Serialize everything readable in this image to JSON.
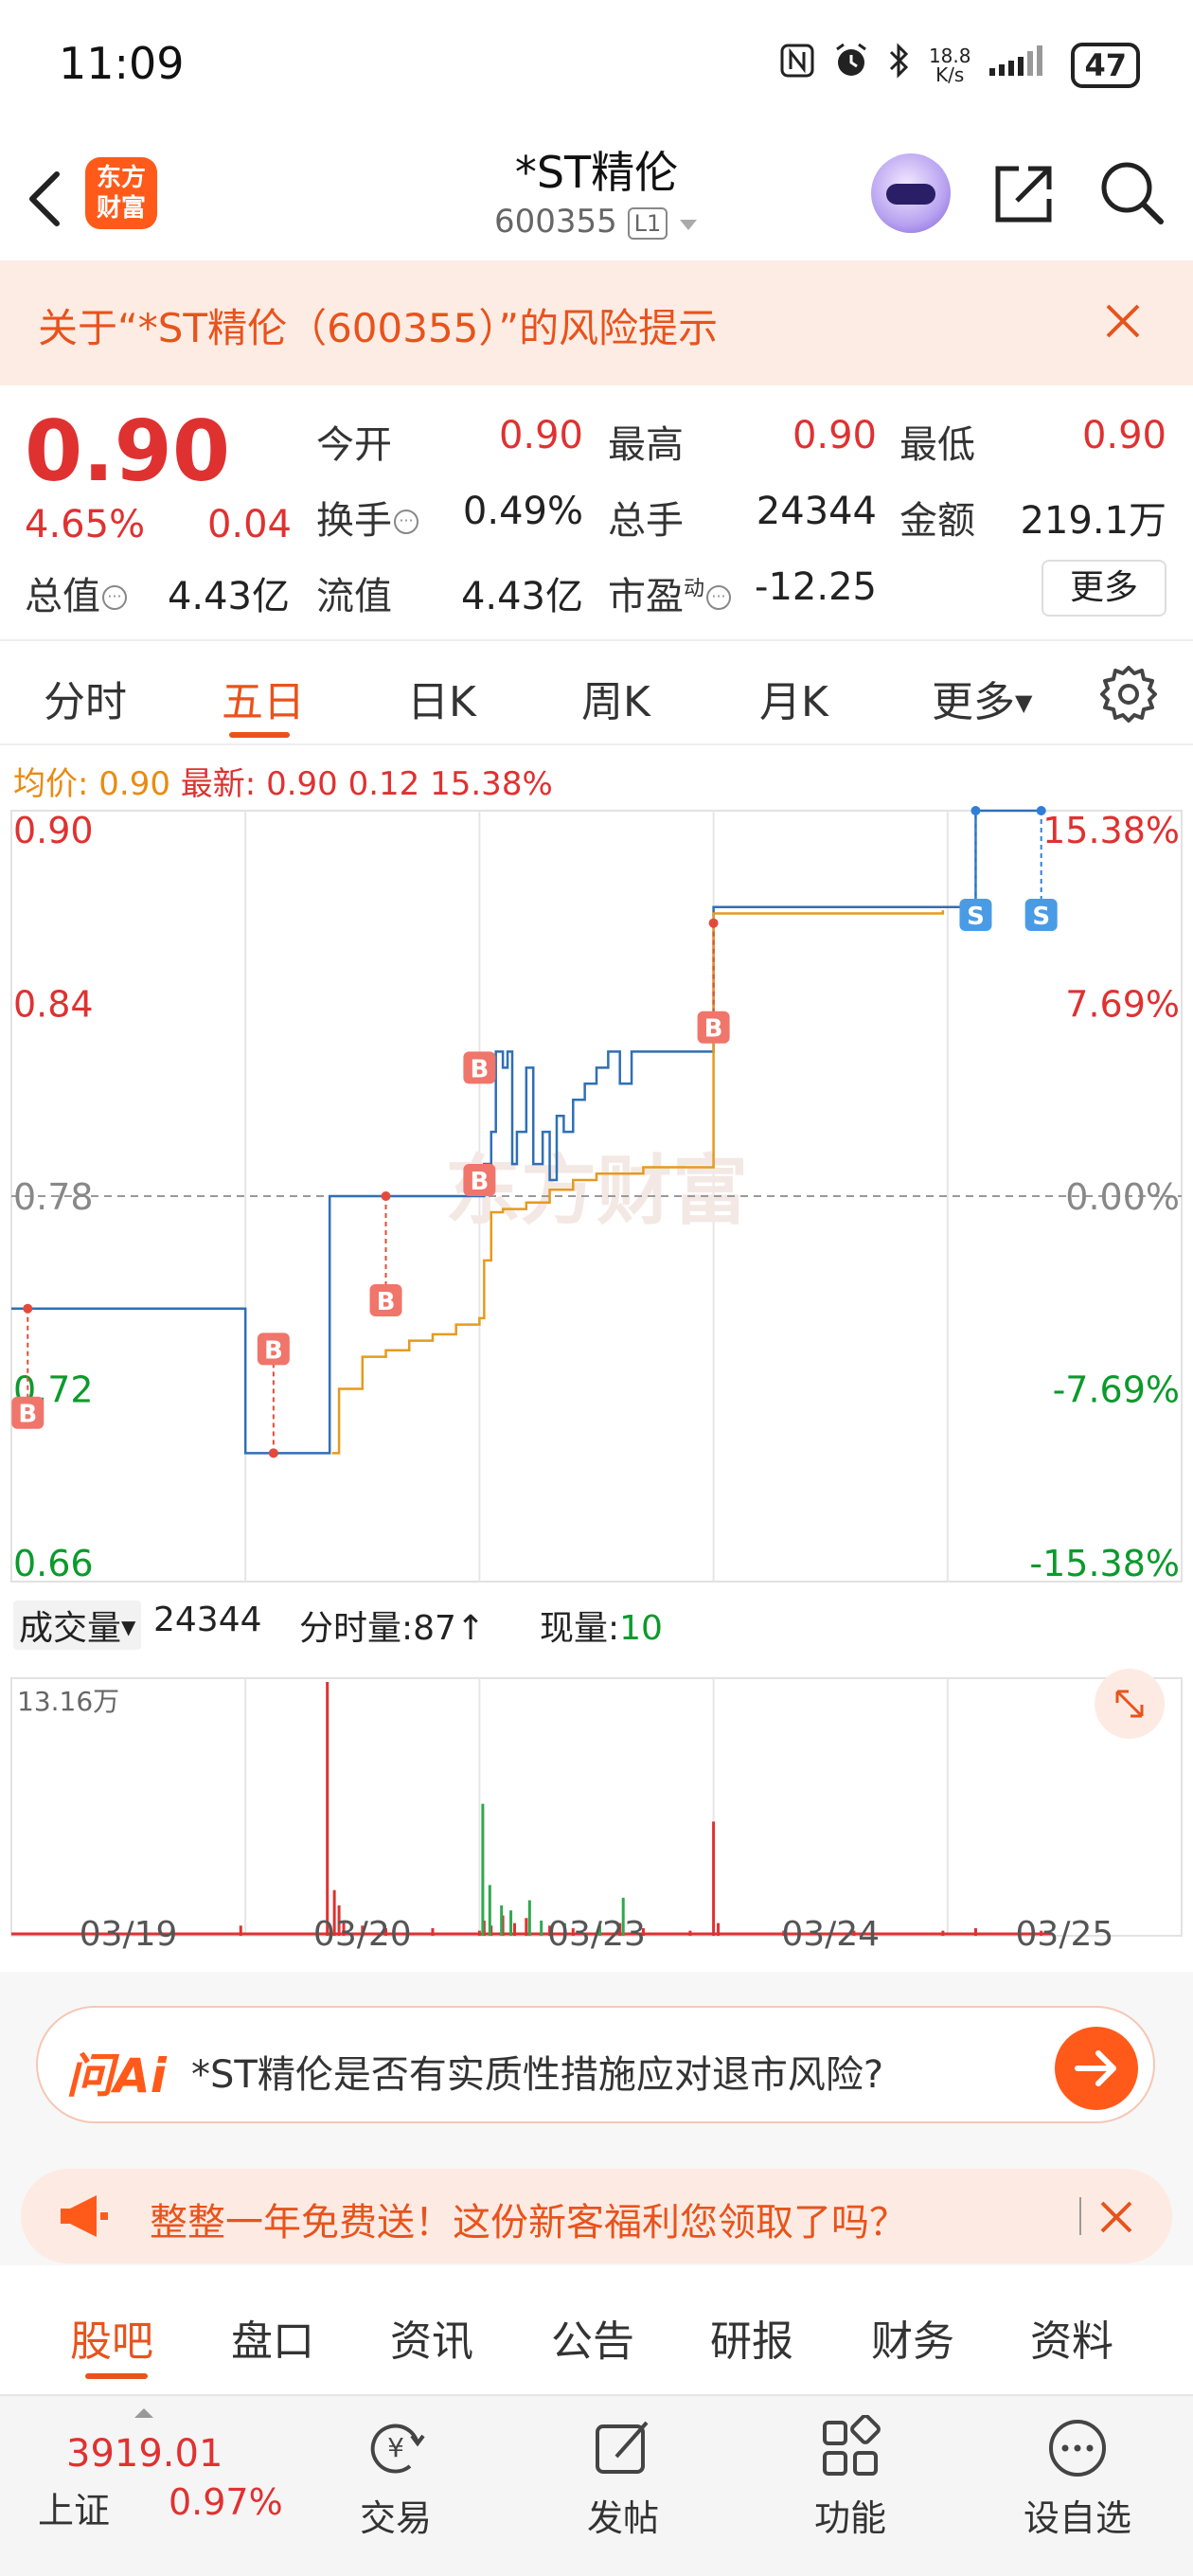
{
  "status_bar": {
    "time": "11:09",
    "net_speed_top": "18.8",
    "net_speed_bottom": "K/s",
    "battery": "47"
  },
  "header": {
    "title": "*ST精伦",
    "code": "600355",
    "level_badge": "L1",
    "logo_line1": "东方",
    "logo_line2": "财富"
  },
  "risk_notice": {
    "text": "关于“*ST精伦（600355）”的风险提示"
  },
  "quote": {
    "price": "0.90",
    "change_pct": "4.65%",
    "change_abs": "0.04",
    "open_label": "今开",
    "open": "0.90",
    "high_label": "最高",
    "high": "0.90",
    "low_label": "最低",
    "low": "0.90",
    "turnover_label": "换手",
    "turnover": "0.49%",
    "volume_label": "总手",
    "volume": "24344",
    "amount_label": "金额",
    "amount": "219.1万",
    "mktcap_label": "总值",
    "mktcap": "4.43亿",
    "float_label": "流值",
    "float_cap": "4.43亿",
    "pe_label": "市盈",
    "pe_sup": "动",
    "pe": "-12.25",
    "more_label": "更多"
  },
  "chart_tabs": [
    "分时",
    "五日",
    "日K",
    "周K",
    "月K",
    "更多"
  ],
  "avg_line": {
    "avg_label": "均价:",
    "avg_value": "0.90",
    "latest_label": "最新:",
    "latest_value": "0.90",
    "latest_chg": "0.12",
    "latest_pct": "15.38%"
  },
  "watermark": "东方财富",
  "chart_data": {
    "type": "line",
    "title": "",
    "days": [
      "03/19",
      "03/20",
      "03/23",
      "03/24",
      "03/25"
    ],
    "y_ticks_left": [
      "0.90",
      "0.84",
      "0.78",
      "0.72",
      "0.66"
    ],
    "y_ticks_right": [
      "15.38%",
      "7.69%",
      "0.00%",
      "-7.69%",
      "-15.38%"
    ],
    "ylim": [
      0.66,
      0.9
    ],
    "prev_close": 0.78,
    "series": [
      {
        "color": "#2f6fb5",
        "points": [
          [
            0.0,
            0.745
          ],
          [
            0.98,
            0.745
          ],
          [
            1.0,
            0.7
          ],
          [
            1.35,
            0.7
          ],
          [
            1.36,
            0.78
          ],
          [
            1.4,
            0.78
          ],
          [
            1.43,
            0.78
          ],
          [
            2.0,
            0.78
          ],
          [
            2.02,
            0.79
          ],
          [
            2.05,
            0.8
          ],
          [
            2.07,
            0.825
          ],
          [
            2.1,
            0.82
          ],
          [
            2.12,
            0.825
          ],
          [
            2.14,
            0.79
          ],
          [
            2.16,
            0.8
          ],
          [
            2.2,
            0.82
          ],
          [
            2.23,
            0.79
          ],
          [
            2.27,
            0.8
          ],
          [
            2.3,
            0.785
          ],
          [
            2.33,
            0.805
          ],
          [
            2.36,
            0.8
          ],
          [
            2.4,
            0.81
          ],
          [
            2.45,
            0.815
          ],
          [
            2.5,
            0.82
          ],
          [
            2.55,
            0.825
          ],
          [
            2.6,
            0.815
          ],
          [
            2.65,
            0.825
          ],
          [
            2.7,
            0.825
          ],
          [
            3.0,
            0.825
          ],
          [
            3.0,
            0.87
          ],
          [
            3.98,
            0.87
          ],
          [
            4.12,
            0.9
          ],
          [
            4.42,
            0.9
          ]
        ]
      },
      {
        "color": "#e69a1e",
        "points": [
          [
            1.37,
            0.7
          ],
          [
            1.4,
            0.72
          ],
          [
            1.5,
            0.73
          ],
          [
            1.6,
            0.732
          ],
          [
            1.7,
            0.735
          ],
          [
            1.8,
            0.737
          ],
          [
            1.9,
            0.74
          ],
          [
            2.0,
            0.742
          ],
          [
            2.02,
            0.76
          ],
          [
            2.05,
            0.775
          ],
          [
            2.1,
            0.776
          ],
          [
            2.2,
            0.778
          ],
          [
            2.3,
            0.782
          ],
          [
            2.4,
            0.785
          ],
          [
            2.5,
            0.787
          ],
          [
            2.7,
            0.789
          ],
          [
            2.85,
            0.789
          ],
          [
            3.0,
            0.79
          ],
          [
            3.0,
            0.868
          ],
          [
            3.5,
            0.868
          ],
          [
            3.98,
            0.869
          ]
        ]
      }
    ],
    "markers": [
      {
        "label": "B",
        "day": 0.07,
        "price": 0.745,
        "offset": 1
      },
      {
        "label": "B",
        "day": 1.12,
        "price": 0.7,
        "offset": -1
      },
      {
        "label": "B",
        "day": 1.6,
        "price": 0.78,
        "offset": 1
      },
      {
        "label": "B",
        "day": 2.0,
        "price": 0.785,
        "offset": 0
      },
      {
        "label": "B",
        "day": 2.0,
        "price": 0.82,
        "offset": 0
      },
      {
        "label": "B",
        "day": 3.0,
        "price": 0.865,
        "offset": 1
      },
      {
        "label": "S",
        "day": 4.12,
        "price": 0.9,
        "offset": 1
      },
      {
        "label": "S",
        "day": 4.4,
        "price": 0.9,
        "offset": 1
      }
    ]
  },
  "volume_row": {
    "select_label": "成交量",
    "total": "24344",
    "tick_label": "分时量:",
    "tick_value": "87",
    "tick_arrow": "↑",
    "now_label": "现量:",
    "now_value": "10"
  },
  "volume_chart": {
    "max_label": "13.16万",
    "bars": [
      [
        0.98,
        4
      ],
      [
        1.35,
        100
      ],
      [
        1.38,
        18
      ],
      [
        1.4,
        12
      ],
      [
        1.42,
        6
      ],
      [
        1.5,
        4
      ],
      [
        1.6,
        3
      ],
      [
        1.8,
        3
      ],
      [
        2.0,
        2
      ],
      [
        2.02,
        6
      ],
      [
        2.05,
        4
      ],
      [
        2.1,
        8
      ],
      [
        2.15,
        5
      ],
      [
        2.2,
        7
      ],
      [
        2.3,
        4
      ],
      [
        2.4,
        3
      ],
      [
        2.6,
        5
      ],
      [
        2.7,
        3
      ],
      [
        2.9,
        2
      ],
      [
        3.0,
        45
      ],
      [
        3.02,
        5
      ],
      [
        3.3,
        2
      ],
      [
        3.6,
        2
      ],
      [
        3.98,
        2
      ],
      [
        4.12,
        3
      ],
      [
        4.4,
        2
      ]
    ],
    "green_bars": [
      [
        2.0,
        52
      ],
      [
        2.03,
        20
      ],
      [
        2.08,
        12
      ],
      [
        2.12,
        10
      ],
      [
        2.2,
        14
      ],
      [
        2.25,
        6
      ],
      [
        2.35,
        5
      ],
      [
        2.5,
        4
      ],
      [
        2.6,
        15
      ]
    ]
  },
  "ai": {
    "logo": "问Ai",
    "question": "*ST精伦是否有实质性措施应对退市风险?"
  },
  "promo": {
    "text": "整整一年免费送！这份新客福利您领取了吗？"
  },
  "content_tabs": [
    "股吧",
    "盘口",
    "资讯",
    "公告",
    "研报",
    "财务",
    "资料"
  ],
  "bottom_nav": {
    "index_value": "3919.01",
    "index_name": "上证",
    "index_pct": "0.97%",
    "items": [
      "交易",
      "发帖",
      "功能",
      "设自选"
    ]
  }
}
